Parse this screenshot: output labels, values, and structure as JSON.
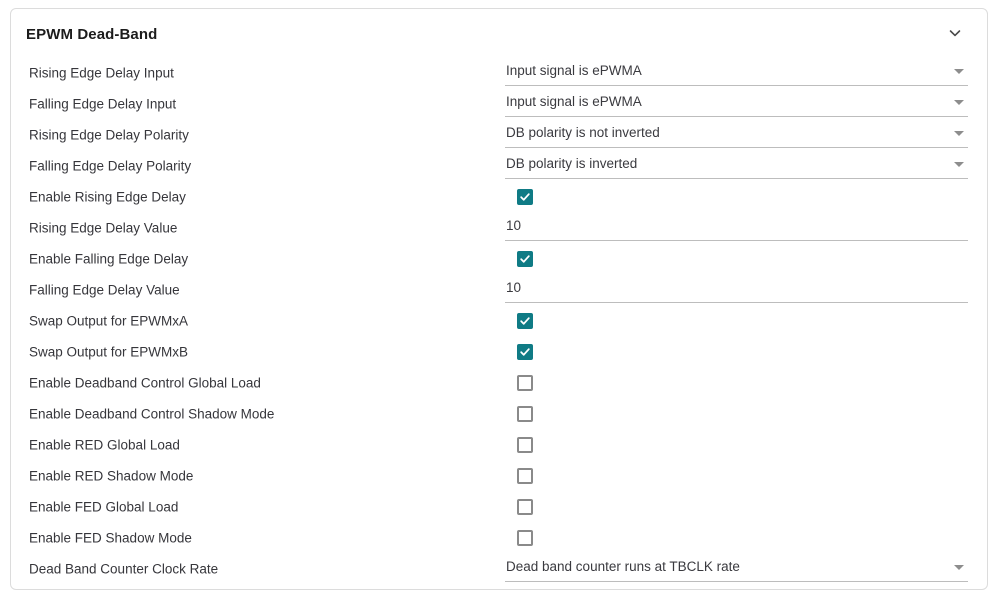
{
  "panel": {
    "title": "EPWM Dead-Band",
    "collapse_icon": "chevron-down-icon",
    "accent_color": "#0f7b85",
    "border_color": "#dcdcdc",
    "underline_color": "#bdbdbd",
    "label_color": "#36363b"
  },
  "rows": [
    {
      "label": "Rising Edge Delay Input",
      "type": "select",
      "value": "Input signal is ePWMA"
    },
    {
      "label": "Falling Edge Delay Input",
      "type": "select",
      "value": "Input signal is ePWMA"
    },
    {
      "label": "Rising Edge Delay Polarity",
      "type": "select",
      "value": "DB polarity is not inverted"
    },
    {
      "label": "Falling Edge Delay Polarity",
      "type": "select",
      "value": "DB polarity is inverted"
    },
    {
      "label": "Enable Rising Edge Delay",
      "type": "checkbox",
      "checked": true
    },
    {
      "label": "Rising Edge Delay Value",
      "type": "text",
      "value": "10"
    },
    {
      "label": "Enable Falling Edge Delay",
      "type": "checkbox",
      "checked": true
    },
    {
      "label": "Falling Edge Delay Value",
      "type": "text",
      "value": "10"
    },
    {
      "label": "Swap Output for EPWMxA",
      "type": "checkbox",
      "checked": true
    },
    {
      "label": "Swap Output for EPWMxB",
      "type": "checkbox",
      "checked": true
    },
    {
      "label": "Enable Deadband Control Global Load",
      "type": "checkbox",
      "checked": false
    },
    {
      "label": "Enable Deadband Control Shadow Mode",
      "type": "checkbox",
      "checked": false
    },
    {
      "label": "Enable RED Global Load",
      "type": "checkbox",
      "checked": false
    },
    {
      "label": "Enable RED Shadow Mode",
      "type": "checkbox",
      "checked": false
    },
    {
      "label": "Enable FED Global Load",
      "type": "checkbox",
      "checked": false
    },
    {
      "label": "Enable FED Shadow Mode",
      "type": "checkbox",
      "checked": false
    },
    {
      "label": "Dead Band Counter Clock Rate",
      "type": "select",
      "value": "Dead band counter runs at TBCLK rate"
    }
  ]
}
